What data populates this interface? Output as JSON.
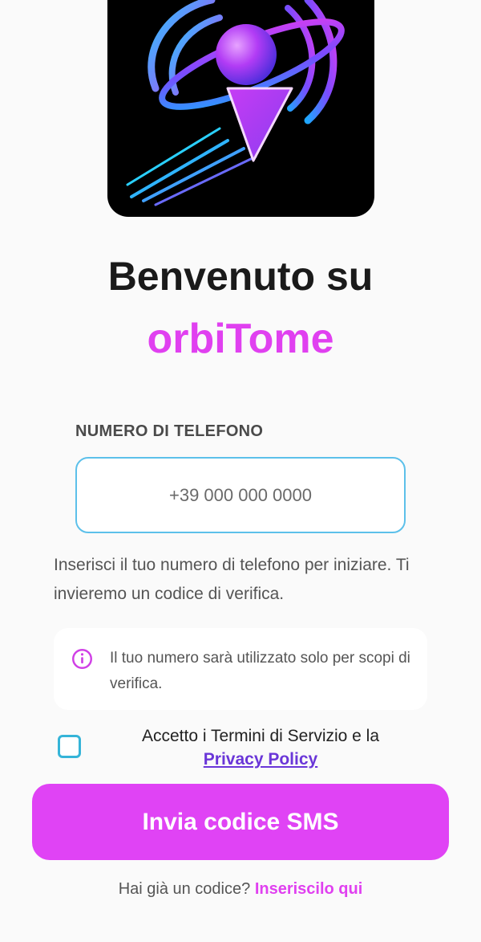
{
  "colors": {
    "accent": "#e040f0",
    "cta_background": "#e043f5",
    "link_purple": "#6a36d8",
    "input_border": "#5cc0ea",
    "checkbox_border": "#35b4d8"
  },
  "header": {
    "title": "Benvenuto su",
    "brand_name": "orbiTome",
    "logo_icon": "orbit-location-pin-icon"
  },
  "phone": {
    "label": "NUMERO DI TELEFONO",
    "placeholder": "+39 000 000 0000",
    "value": ""
  },
  "helper_text": "Inserisci il tuo numero di telefono per iniziare. Ti invieremo un codice di verifica.",
  "info": {
    "icon": "info-icon",
    "text": "Il tuo numero sarà utilizzato solo per scopi di verifica."
  },
  "terms": {
    "checked": false,
    "text": "Accetto i Termini di Servizio e la",
    "link_text": "Privacy Policy"
  },
  "cta": {
    "label": "Invia codice SMS"
  },
  "footer": {
    "prompt": "Hai già un codice?",
    "link_text": "Inseriscilo qui"
  }
}
